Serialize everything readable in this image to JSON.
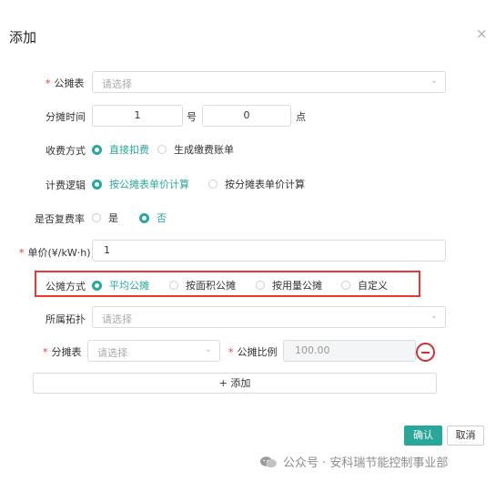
{
  "dialog": {
    "title": "添加",
    "close_glyph": "×"
  },
  "fields": {
    "meter": {
      "label": "公摊表",
      "placeholder": "请选择"
    },
    "time": {
      "label": "分摊时间",
      "day_value": "1",
      "day_unit": "号",
      "hour_value": "0",
      "hour_unit": "点"
    },
    "charge_mode": {
      "label": "收费方式",
      "options": [
        "直接扣费",
        "生成缴费账单"
      ],
      "selected": 0
    },
    "billing_logic": {
      "label": "计费逻辑",
      "options": [
        "按公摊表单价计算",
        "按分摊表单价计算"
      ],
      "selected": 0
    },
    "multi_rate": {
      "label": "是否复费率",
      "options": [
        "是",
        "否"
      ],
      "selected": 1
    },
    "unit_price": {
      "label": "单价(¥/kW·h)",
      "value": "1"
    },
    "share_mode": {
      "label": "公摊方式",
      "options": [
        "平均公摊",
        "按面积公摊",
        "按用量公摊",
        "自定义"
      ],
      "selected": 0
    },
    "topology": {
      "label": "所属拓扑",
      "placeholder": "请选择"
    },
    "sub_meter": {
      "label": "分摊表",
      "placeholder": "请选择"
    },
    "ratio": {
      "label": "公摊比例",
      "value": "100.00"
    }
  },
  "add_button": {
    "label": "+ 添加"
  },
  "footer": {
    "confirm": "确认",
    "cancel": "取消"
  },
  "watermark": {
    "text": "公众号 · 安科瑞节能控制事业部"
  },
  "colors": {
    "accent": "#2aa79b",
    "highlight": "#e53935",
    "required": "#e53935"
  },
  "icons": {
    "close": "close-icon",
    "dropdown": "chevron-down-icon",
    "remove": "minus-circle-icon",
    "watermark": "wechat-icon"
  }
}
